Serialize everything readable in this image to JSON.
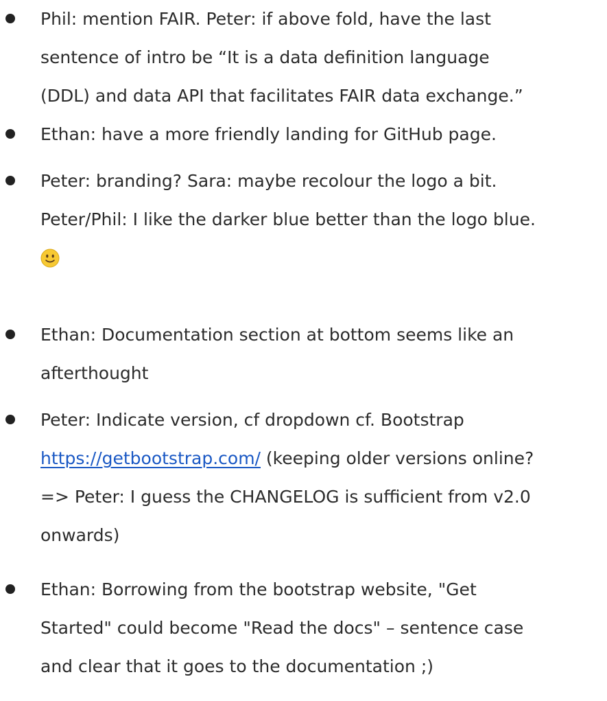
{
  "notes": [
    {
      "lines": [
        "Phil: mention FAIR. Peter: if above fold, have the last",
        "sentence of intro be “It is a data definition language",
        "(DDL) and data API that facilitates FAIR data exchange.”"
      ]
    },
    {
      "lines": [
        "Ethan: have a more friendly landing for GitHub page."
      ]
    },
    {
      "lines": [
        "Peter: branding? Sara: maybe recolour the logo a bit.",
        "Peter/Phil: I like the darker blue better than the logo blue."
      ],
      "emoji": "slightly-smiling-face"
    },
    {
      "lines": [
        "Ethan: Documentation section at bottom seems like an",
        "afterthought"
      ]
    },
    {
      "line0": "Peter: Indicate version, cf dropdown cf. Bootstrap",
      "link_text": "https://getbootstrap.com/",
      "line1_rest": " (keeping older versions online?",
      "line2": "=> Peter: I guess the CHANGELOG is sufficient from v2.0",
      "line3": "onwards)"
    },
    {
      "lines": [
        "Ethan: Borrowing from the bootstrap website, \"Get",
        "Started\" could become \"Read the docs\" – sentence case",
        "and clear that it goes to the documentation ;)"
      ]
    }
  ],
  "colors": {
    "text": "#2b2b2b",
    "link": "#1a58c4",
    "bullet": "#222222",
    "emoji_face": "#f7c933",
    "background": "#ffffff"
  }
}
